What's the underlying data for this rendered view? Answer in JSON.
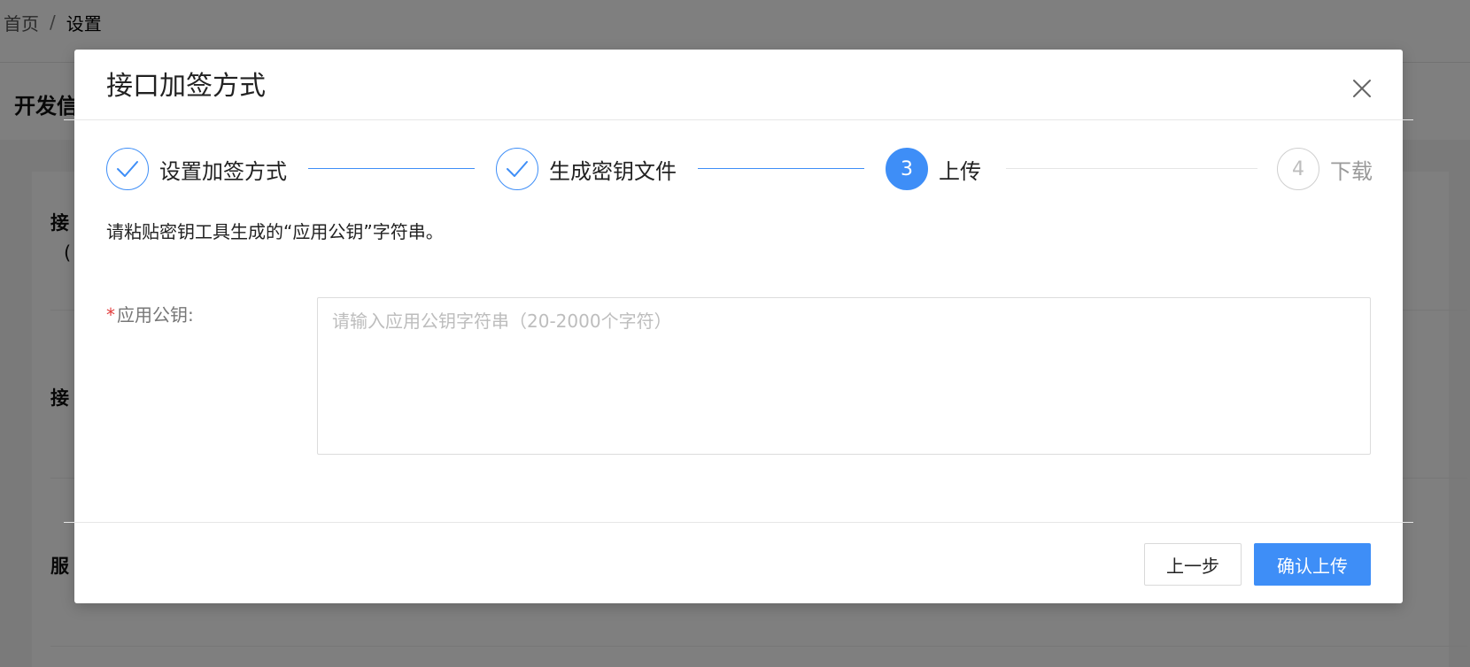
{
  "breadcrumb": {
    "home": "首页",
    "separator": "/",
    "current": "设置"
  },
  "background": {
    "section_title": "开发信",
    "labels": [
      "接",
      "(",
      "接",
      "服"
    ]
  },
  "modal": {
    "title": "接口加签方式",
    "close_icon": "close-icon",
    "steps": [
      {
        "label": "设置加签方式",
        "status": "done",
        "icon": "check-icon"
      },
      {
        "label": "生成密钥文件",
        "status": "done",
        "icon": "check-icon"
      },
      {
        "label": "上传",
        "status": "active",
        "number": "3"
      },
      {
        "label": "下载",
        "status": "wait",
        "number": "4"
      }
    ],
    "instruction": "请粘贴密钥工具生成的“应用公钥”字符串。",
    "form": {
      "required_mark": "*",
      "label": "应用公钥:",
      "placeholder": "请输入应用公钥字符串（20-2000个字符）",
      "value": ""
    },
    "buttons": {
      "prev": "上一步",
      "confirm": "确认上传"
    }
  },
  "colors": {
    "primary": "#3e8ef7",
    "required": "#e23b3b",
    "mask": "rgba(0,0,0,0.5)"
  }
}
